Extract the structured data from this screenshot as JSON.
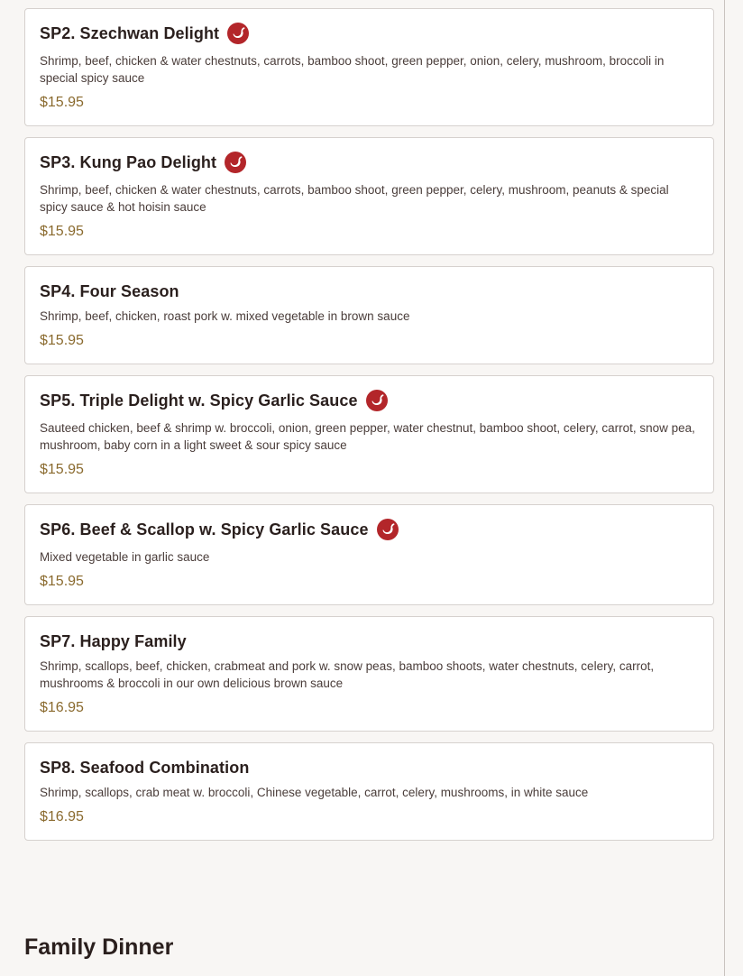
{
  "colors": {
    "page_background": "#f8f6f4",
    "card_background": "#ffffff",
    "card_border": "#d6d1ce",
    "title_text": "#2a1f1d",
    "description_text": "#4a3d3a",
    "price_text": "#8a6a2e",
    "spicy_badge": "#b3262a"
  },
  "menu": {
    "items": [
      {
        "title": "SP2. Szechwan Delight",
        "spicy": true,
        "icon": "chili-pepper-icon",
        "description": "Shrimp, beef, chicken & water chestnuts, carrots, bamboo shoot, green pepper, onion, celery, mushroom, broccoli in special spicy sauce",
        "price": "$15.95"
      },
      {
        "title": "SP3. Kung Pao Delight",
        "spicy": true,
        "icon": "chili-pepper-icon",
        "description": "Shrimp, beef, chicken & water chestnuts, carrots, bamboo shoot, green pepper, celery, mushroom, peanuts & special spicy sauce & hot hoisin sauce",
        "price": "$15.95"
      },
      {
        "title": "SP4. Four Season",
        "spicy": false,
        "description": "Shrimp, beef, chicken, roast pork w. mixed vegetable in brown sauce",
        "price": "$15.95"
      },
      {
        "title": "SP5. Triple Delight w. Spicy Garlic Sauce",
        "spicy": true,
        "icon": "chili-pepper-icon",
        "description": "Sauteed chicken, beef & shrimp w. broccoli, onion, green pepper, water chestnut, bamboo shoot, celery, carrot, snow pea, mushroom, baby corn in a light sweet & sour spicy sauce",
        "price": "$15.95"
      },
      {
        "title": "SP6. Beef & Scallop w. Spicy Garlic Sauce",
        "spicy": true,
        "icon": "chili-pepper-icon",
        "description": "Mixed vegetable in garlic sauce",
        "price": "$15.95"
      },
      {
        "title": "SP7. Happy Family",
        "spicy": false,
        "description": "Shrimp, scallops, beef, chicken, crabmeat and pork w. snow peas, bamboo shoots, water chestnuts, celery, carrot, mushrooms & broccoli in our own delicious brown sauce",
        "price": "$16.95"
      },
      {
        "title": "SP8. Seafood Combination",
        "spicy": false,
        "description": "Shrimp, scallops, crab meat w. broccoli, Chinese vegetable, carrot, celery, mushrooms, in white sauce",
        "price": "$16.95"
      }
    ]
  },
  "next_section": {
    "title": "Family Dinner"
  }
}
